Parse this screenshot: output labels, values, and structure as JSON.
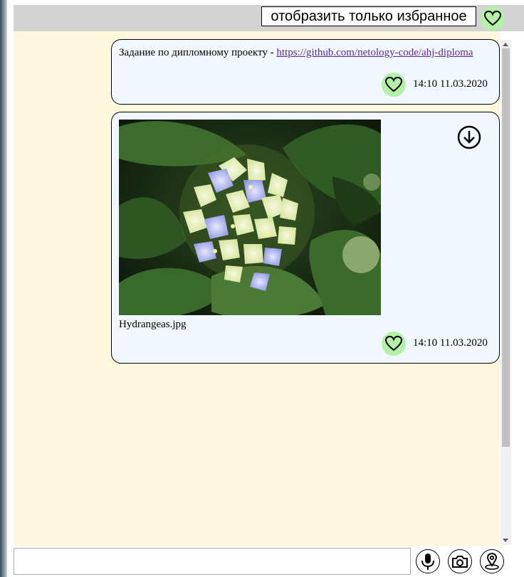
{
  "header": {
    "filter_button_label": "отобразить только избранное"
  },
  "messages": [
    {
      "text": "Задание по дипломному проекту - ",
      "link": "https://github.com/netology-code/ahj-diploma",
      "time": "14:10 11.03.2020"
    },
    {
      "file_name": "Hydrangeas.jpg",
      "time": "14:10 11.03.2020"
    }
  ],
  "composer": {
    "input_value": "",
    "buttons": [
      "microphone-icon",
      "camera-icon",
      "location-pin-icon"
    ]
  },
  "colors": {
    "favorite_bg": "#b4f0a8",
    "chat_bg": "#fff7dd",
    "message_bg": "#f0f7ff",
    "link": "#5a2a8c"
  }
}
